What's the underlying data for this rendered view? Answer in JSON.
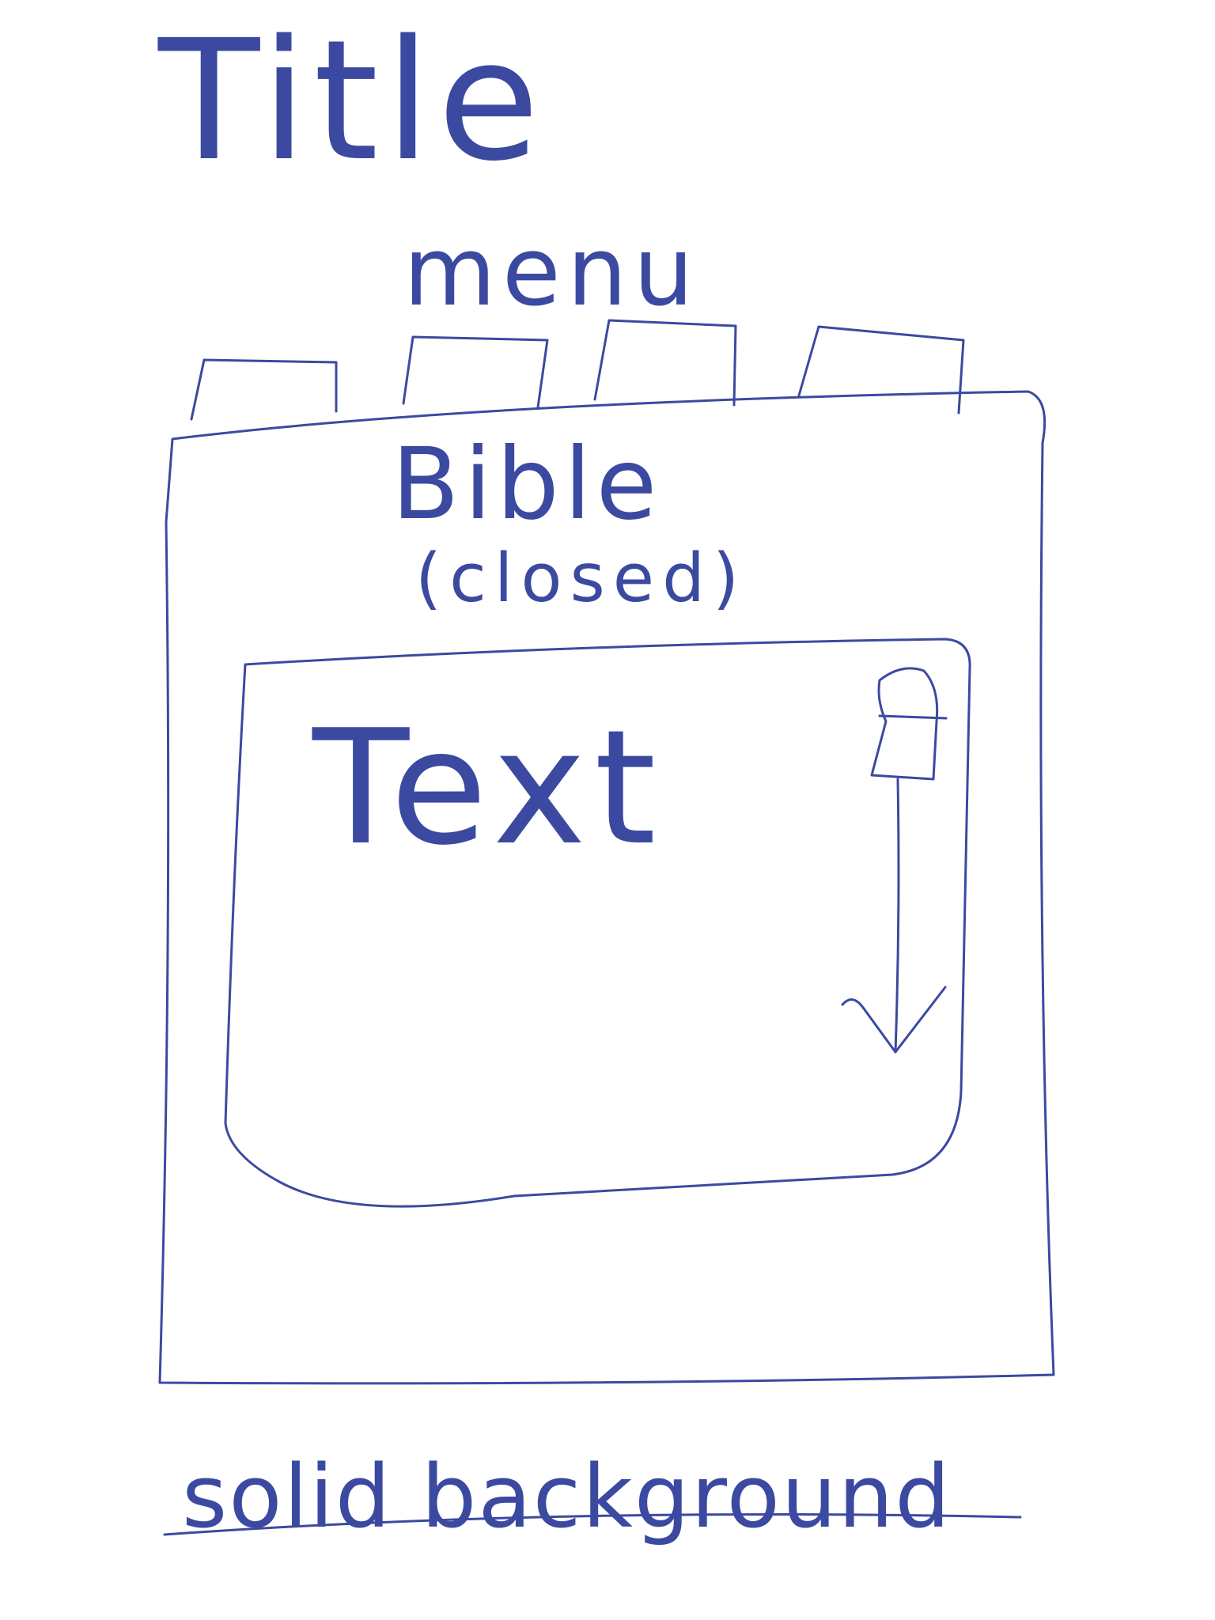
{
  "title": "Title",
  "menu": {
    "label": "menu",
    "tabs": [
      {
        "id": "tab-1"
      },
      {
        "id": "tab-2"
      },
      {
        "id": "tab-3"
      },
      {
        "id": "tab-4"
      }
    ]
  },
  "panel": {
    "heading": "Bible",
    "heading_note": "(closed)"
  },
  "content": {
    "label": "Text"
  },
  "footer": {
    "note": "solid background"
  },
  "colors": {
    "ink": "#3b4aa0",
    "background": "#ffffff"
  }
}
